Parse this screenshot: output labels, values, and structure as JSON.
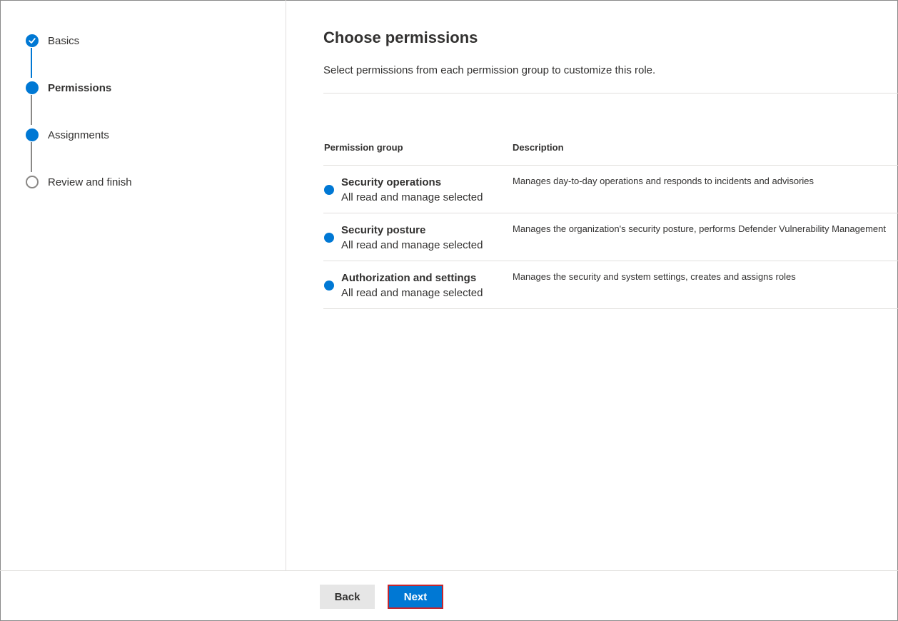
{
  "steps": [
    {
      "label": "Basics",
      "state": "completed",
      "icon": "checkmark-icon"
    },
    {
      "label": "Permissions",
      "state": "current"
    },
    {
      "label": "Assignments",
      "state": "upcoming-filled"
    },
    {
      "label": "Review and finish",
      "state": "upcoming"
    }
  ],
  "main": {
    "title": "Choose permissions",
    "subtitle": "Select permissions from each permission group to customize this role."
  },
  "table": {
    "columns": [
      "Permission group",
      "Description"
    ],
    "rows": [
      {
        "name": "Security operations",
        "status": "All read and manage selected",
        "description": "Manages day-to-day operations and responds to incidents and advisories"
      },
      {
        "name": "Security posture",
        "status": "All read and manage selected",
        "description": "Manages the organization's security posture, performs Defender Vulnerability Management"
      },
      {
        "name": "Authorization and settings",
        "status": "All read and manage selected",
        "description": "Manages the security and system settings, creates and assigns roles"
      }
    ]
  },
  "footer": {
    "back_label": "Back",
    "next_label": "Next"
  },
  "colors": {
    "accent": "#0078d4",
    "highlight_border": "#c4262e"
  }
}
